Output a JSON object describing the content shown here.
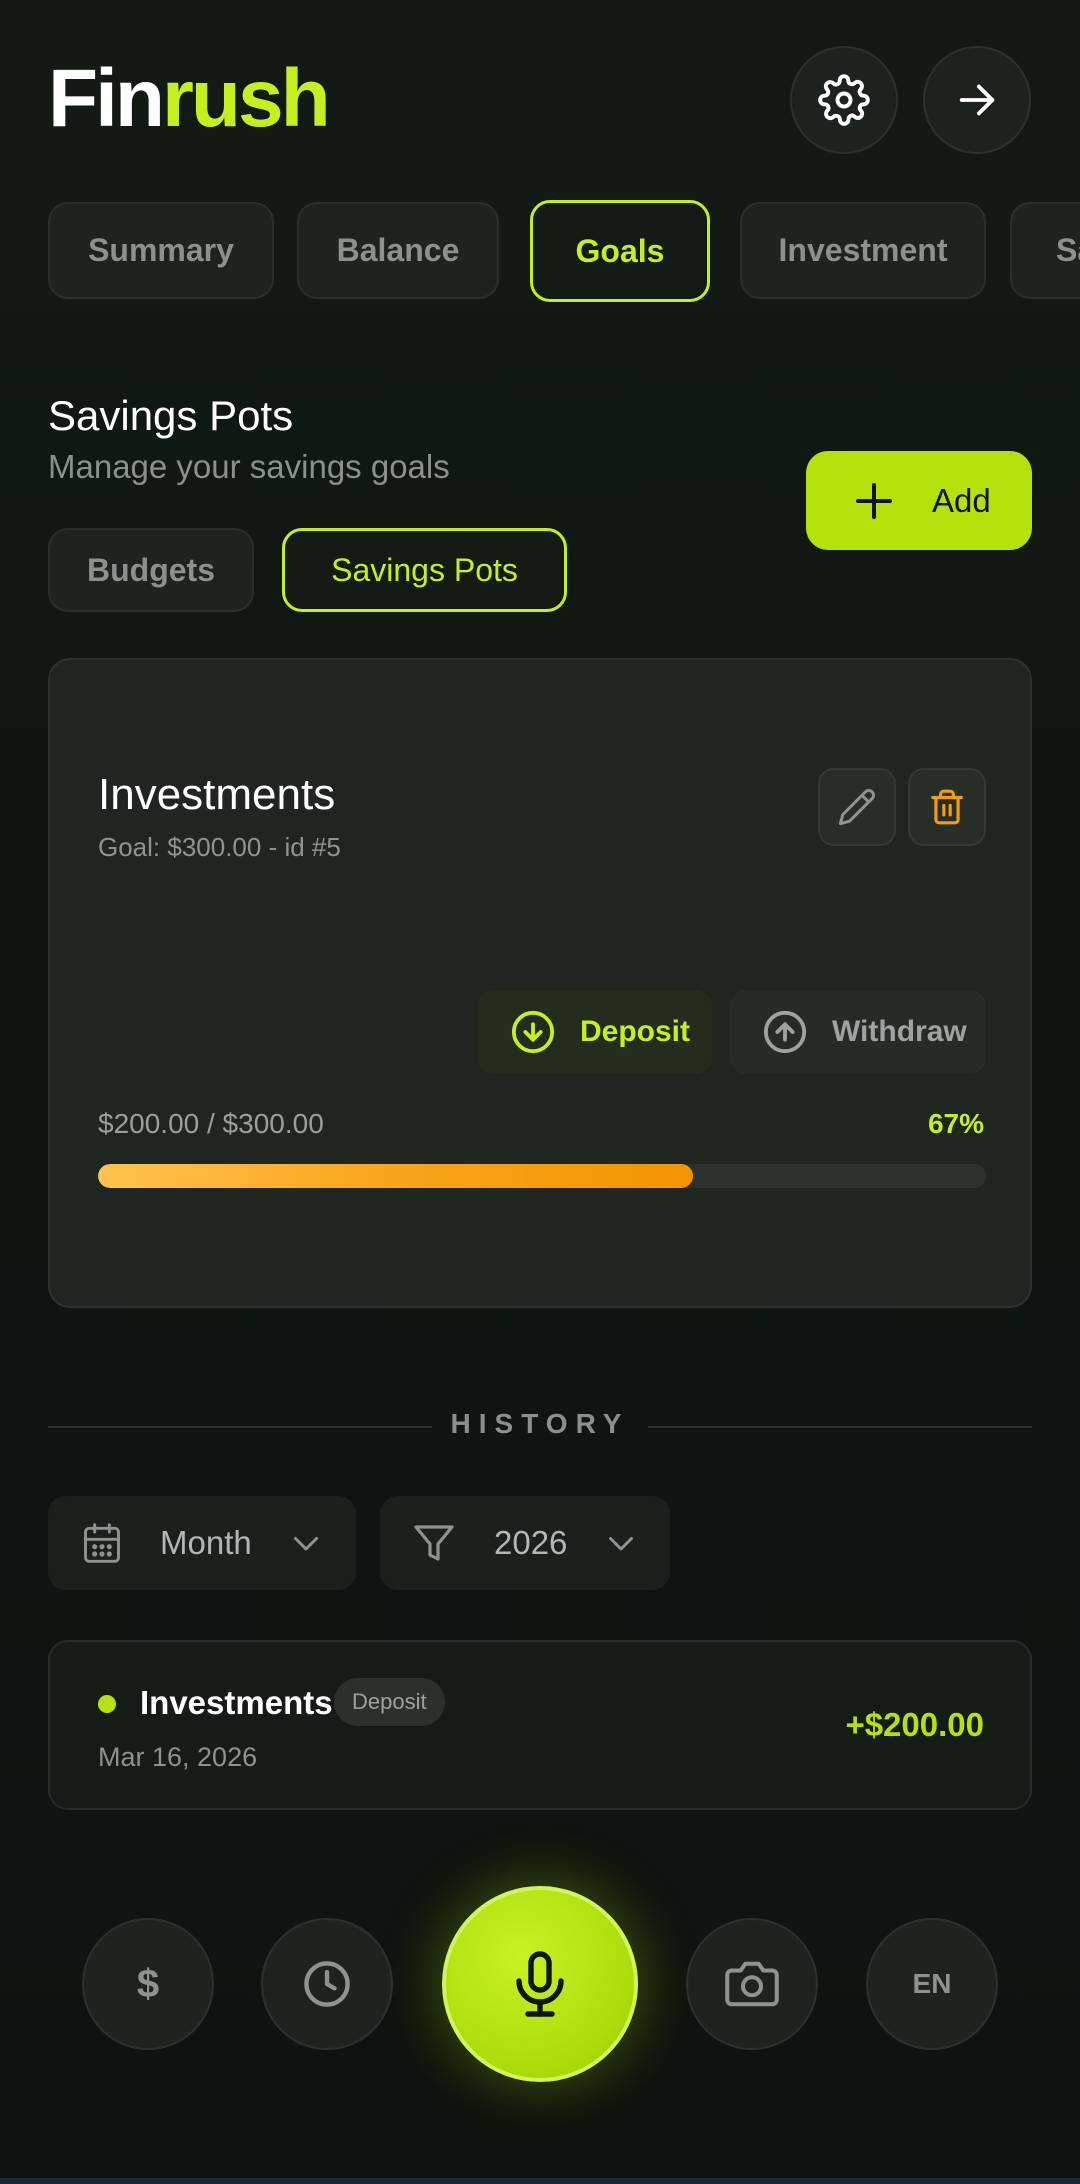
{
  "app": {
    "logo_part1": "Fin",
    "logo_part2": "rush",
    "accent_color": "#c5ef1f",
    "header_icons": [
      "gear-icon",
      "arrow-right-icon"
    ]
  },
  "tabs": [
    {
      "label": "Summary",
      "active": false
    },
    {
      "label": "Balance",
      "active": false
    },
    {
      "label": "Goals",
      "active": true
    },
    {
      "label": "Investment",
      "active": false
    },
    {
      "label": "Sa",
      "active": false
    }
  ],
  "section": {
    "title": "Savings Pots",
    "subtitle": "Manage your savings goals",
    "add_label": "Add"
  },
  "segments": [
    {
      "label": "Budgets",
      "active": false
    },
    {
      "label": "Savings Pots",
      "active": true
    }
  ],
  "pot": {
    "name": "Investments",
    "goal_text": "Goal: $300.00 - id #5",
    "deposit_label": "Deposit",
    "withdraw_label": "Withdraw",
    "amount_text": "$200.00 / $300.00",
    "percent_text": "67%",
    "progress": 0.67
  },
  "history": {
    "title": "HISTORY",
    "period_filter": "Month",
    "year_filter": "2026",
    "transactions": [
      {
        "name": "Investments",
        "type": "Deposit",
        "date": "Mar 16, 2026",
        "amount": "+$200.00"
      }
    ]
  },
  "bottom_nav": {
    "currency_symbol": "$",
    "language": "EN",
    "icons": [
      "dollar-icon",
      "clock-icon",
      "microphone-icon",
      "camera-icon",
      "language-icon"
    ]
  }
}
